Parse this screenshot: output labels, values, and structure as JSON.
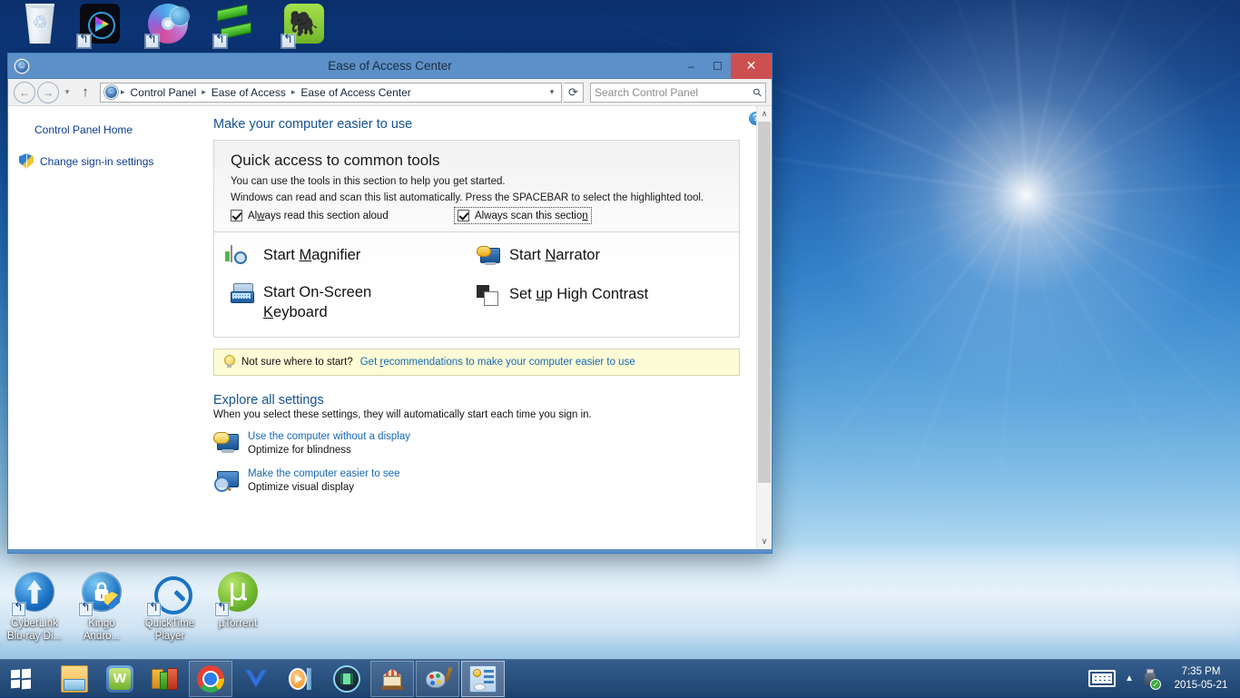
{
  "desktop": {
    "icons_top": [
      {
        "name": "Recycle Bin",
        "label": "",
        "glyph": "recycle-bin-icon"
      },
      {
        "name": "Media Player",
        "label": "",
        "glyph": "media-player-icon"
      },
      {
        "name": "Disc Burner",
        "label": "",
        "glyph": "disc-burner-icon"
      },
      {
        "name": "Converter",
        "label": "",
        "glyph": "green-sync-icon"
      },
      {
        "name": "Evernote",
        "label": "",
        "glyph": "evernote-icon"
      }
    ],
    "icons_bottom": [
      {
        "label_line1": "CyberLink",
        "label_line2": "Blu-ray Di...",
        "glyph": "cyberlink-icon"
      },
      {
        "label_line1": "Kingo",
        "label_line2": "Andro...",
        "glyph": "kingo-android-root-icon"
      },
      {
        "label_line1": "QuickTime",
        "label_line2": "Player",
        "glyph": "quicktime-icon"
      },
      {
        "label_line1": "µTorrent",
        "label_line2": "",
        "glyph": "utorrent-icon"
      }
    ]
  },
  "taskbar": {
    "start_label": "Start",
    "buttons": [
      {
        "name": "file-explorer",
        "state": "pinned"
      },
      {
        "name": "wondershare",
        "state": "pinned"
      },
      {
        "name": "winrar",
        "state": "pinned"
      },
      {
        "name": "google-chrome",
        "state": "running"
      },
      {
        "name": "malwarebytes",
        "state": "pinned"
      },
      {
        "name": "media-player",
        "state": "pinned"
      },
      {
        "name": "video-converter",
        "state": "pinned"
      },
      {
        "name": "carousel-app",
        "state": "running"
      },
      {
        "name": "paint",
        "state": "running"
      },
      {
        "name": "control-panel",
        "state": "active"
      }
    ],
    "tray": {
      "keyboard_icon": "touch-keyboard-icon",
      "show_hidden_icon": "chevron-up-icon",
      "usb_icon": "safely-remove-hardware-icon",
      "time": "7:35 PM",
      "date": "2015-05-21"
    }
  },
  "window": {
    "title": "Ease of Access Center",
    "title_icon": "ease-of-access-icon",
    "controls": {
      "minimize": "–",
      "maximize": "☐",
      "close": "✕"
    },
    "nav": {
      "back": "←",
      "forward": "→",
      "recent_caret": "▾",
      "up": "↑",
      "refresh": "⟳",
      "address_caret": "▾",
      "breadcrumbs": [
        "Control Panel",
        "Ease of Access",
        "Ease of Access Center"
      ],
      "separator": "▸"
    },
    "search": {
      "placeholder": "Search Control Panel",
      "value": "",
      "icon": "search-icon"
    },
    "help_button": "?"
  },
  "sidebar": {
    "items": [
      {
        "label": "Control Panel Home",
        "icon": null
      },
      {
        "label": "Change sign-in settings",
        "icon": "uac-shield-icon"
      }
    ]
  },
  "main": {
    "heading": "Make your computer easier to use",
    "quick_access": {
      "title": "Quick access to common tools",
      "desc1": "You can use the tools in this section to help you get started.",
      "desc2": "Windows can read and scan this list automatically.  Press the SPACEBAR to select the highlighted tool.",
      "checkboxes": [
        {
          "label": "Always read this section aloud",
          "checked": true,
          "focused": false,
          "pre": "Al",
          "accel": "w",
          "post": "ays read this section aloud"
        },
        {
          "label": "Always scan this section",
          "checked": true,
          "focused": true,
          "pre": "Always scan this sectio",
          "accel": "n",
          "post": ""
        }
      ],
      "tools": [
        {
          "pre": "Start ",
          "accel": "M",
          "post": "agnifier",
          "label": "Start Magnifier",
          "icon": "magnifier-icon",
          "col": 0
        },
        {
          "pre": "Start On-Screen ",
          "accel": "K",
          "post": "eyboard",
          "label": "Start On-Screen Keyboard",
          "icon": "on-screen-keyboard-icon",
          "col": 0
        },
        {
          "pre": "Start ",
          "accel": "N",
          "post": "arrator",
          "label": "Start Narrator",
          "icon": "narrator-icon",
          "col": 1
        },
        {
          "pre": "Set ",
          "accel": "u",
          "post": "p High Contrast",
          "label": "Set up High Contrast",
          "icon": "high-contrast-icon",
          "col": 1
        }
      ]
    },
    "tip": {
      "icon": "lightbulb-icon",
      "question": "Not sure where to start?",
      "link_pre": "Get ",
      "link_accel": "r",
      "link_post": "ecommendations to make your computer easier to use"
    },
    "explore": {
      "heading": "Explore all settings",
      "subtext": "When you select these settings, they will automatically start each time you sign in.",
      "items": [
        {
          "link": "Use the computer without a display",
          "sub": "Optimize for blindness",
          "icon": "narrator-display-icon"
        },
        {
          "link": "Make the computer easier to see",
          "sub": "Optimize visual display",
          "icon": "magnifier-display-icon"
        }
      ]
    }
  },
  "scrollbar": {
    "up": "∧",
    "down": "∨"
  },
  "colors": {
    "titlebar": "#5d90c8",
    "close_button": "#cd5050",
    "link": "#1668b8",
    "heading": "#14528f",
    "tip_background": "#fdfbd5"
  }
}
